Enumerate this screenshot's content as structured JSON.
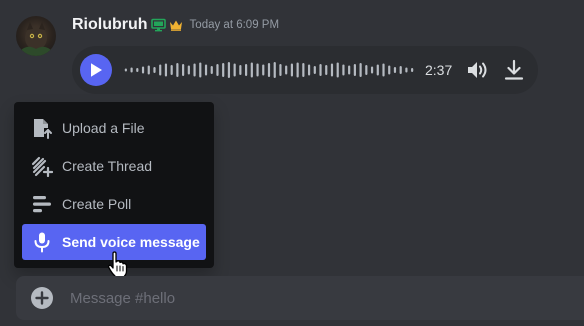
{
  "message": {
    "username": "Riolubruh",
    "timestamp": "Today at 6:09 PM",
    "badges": [
      "monitor-icon",
      "crown-icon"
    ]
  },
  "voice_message": {
    "duration": "2:37",
    "play_icon": "play-icon",
    "volume_icon": "volume-icon",
    "download_icon": "download-icon"
  },
  "attach_menu": {
    "items": [
      {
        "label": "Upload a File",
        "icon": "file-upload-icon"
      },
      {
        "label": "Create Thread",
        "icon": "thread-icon"
      },
      {
        "label": "Create Poll",
        "icon": "poll-icon"
      },
      {
        "label": "Send voice message",
        "icon": "microphone-icon",
        "active": true
      }
    ]
  },
  "composer": {
    "placeholder": "Message #hello"
  },
  "colors": {
    "background": "#313338",
    "accent": "#5865f2",
    "menu_background": "#111214",
    "composer_background": "#383a40",
    "badge_green": "#23a55a",
    "crown_gold": "#f0b232"
  }
}
